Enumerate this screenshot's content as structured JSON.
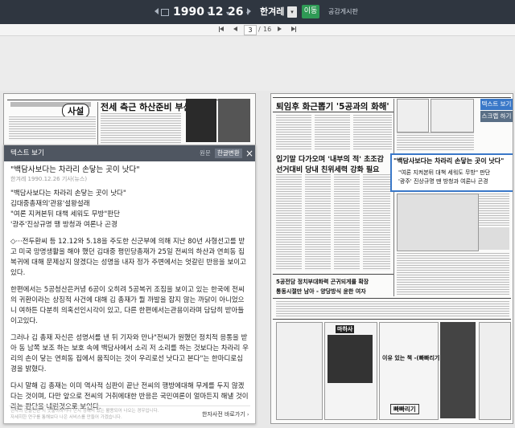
{
  "header": {
    "year": "1990",
    "month": "12",
    "day": "26",
    "newspaper": "한겨레",
    "go_label": "이동",
    "notice_link": "공감게시판"
  },
  "pager": {
    "current": "3",
    "separator": "/",
    "total": "16"
  },
  "left_page": {
    "section_label": "사설",
    "headline": "전세 측근 하산준비 부산"
  },
  "right_page": {
    "headline": "퇴임후 화근뽑기 '5공과의 화해'",
    "sub_headline_1": "입기말 다가오며 '내부의 적' 초조감",
    "sub_headline_2": "선거대비 당내 친위세력 강화 필요",
    "boxed_title": "\"백담사보다는 차라리 손닿는 곳이 낫다\"",
    "boxed_sub_1": "\"여론 지켜본뒤 대책 세워도 무방\" 판단",
    "boxed_sub_2": "'광주' 진상규명 땐 방청과 여론나 곤경",
    "bottom_headline": "5공전담 정치부대화력 곤귀되게를 확장",
    "bottom_sub": "통동시절만 남아 - 양당방식 윤한 여자",
    "ad_title": "마하사",
    "ad_slogan": "이유 있는 책 -(빠빠리기)",
    "ad_bottom": "빠빠리기"
  },
  "side_buttons": {
    "text_view": "텍스트 보기",
    "scrap": "스크랩 하기"
  },
  "text_panel": {
    "title": "텍스트 보기",
    "tab_original": "원문",
    "tab_korean": "한글변환",
    "close_icon": "×",
    "article_title": "\"백담사보다는 차라리 손닿는 곳이 낫다\"",
    "meta": "한겨레 1990.12.26 기사(뉴스)",
    "lines": [
      "\"백담사보다는 차라리 손닿는 곳이 낫다\"",
      "김대중총재의'관용'설왕설래",
      "\"여론 지켜본뒤 대책 세워도 무방\"판단",
      "'광주'진상규명 땡 방청과 여론나 곤경"
    ],
    "paragraphs": [
      "◇···전두환씨 등 12.12와 5.18을 주도한 신군부에 의해 지난 80년 사형선고를 받고 미국 망명생활을 해야 했던 김대중 평민당총재가 25일 전씨의 하산과 연희동 집 복귀에 대해 문제삼지 않겠다는 성명을 내자 정가 주변에서는 엇갈린 반응을 보이고 있다.",
      "한편에서는 5공청산은커녕 6공이 오히려 5공복귀 조짐을 보이고 있는 한국에 전씨의 귀환이라는 상징적 사건에 대해 김 총재가 뭘 까발을 잡지 않는 까닭이 아니었으니 여하튼 다분히 의혹선인시각이 있고, 다른 한편에서는관용이라며 담담히 받아들이고있다.",
      "그러나 김 총재 자신은 성명서를 낸 뒤 기자와 만나\"전씨가 원했던 정치적 응통을 받아 동 남쪽 보조 하는 보호 속에 백담사에서 소리 저 소리를 하는 것보다는 차라리 우리의 손이 닿는 연희동 집에서 움직이는 것이 우리로선 낫다고 본다\"는 한마디로심경을 밝혔다.",
      "다시 말해 김 총재는 이미 역사적 심판이 끝난 전씨의 행방에대해 무게를 두지 않겠다는 것이며, 다만 앞으로 전씨의 거취에대한 반응은 국민여론이 얼마든지 해낼 것이라는 판단을 내린것으로 보인다."
    ],
    "footer_note_1": "한자의 한글변환 시 뜻풀이하거나 단지 정해져 있는 활용되어 나오는 경우입니다.",
    "footer_note_2": "자세히한 연구를 통해보다 나은 서비스를 만들어 가겠습니다.",
    "dictionary_link": "한자사전 바로가기"
  }
}
